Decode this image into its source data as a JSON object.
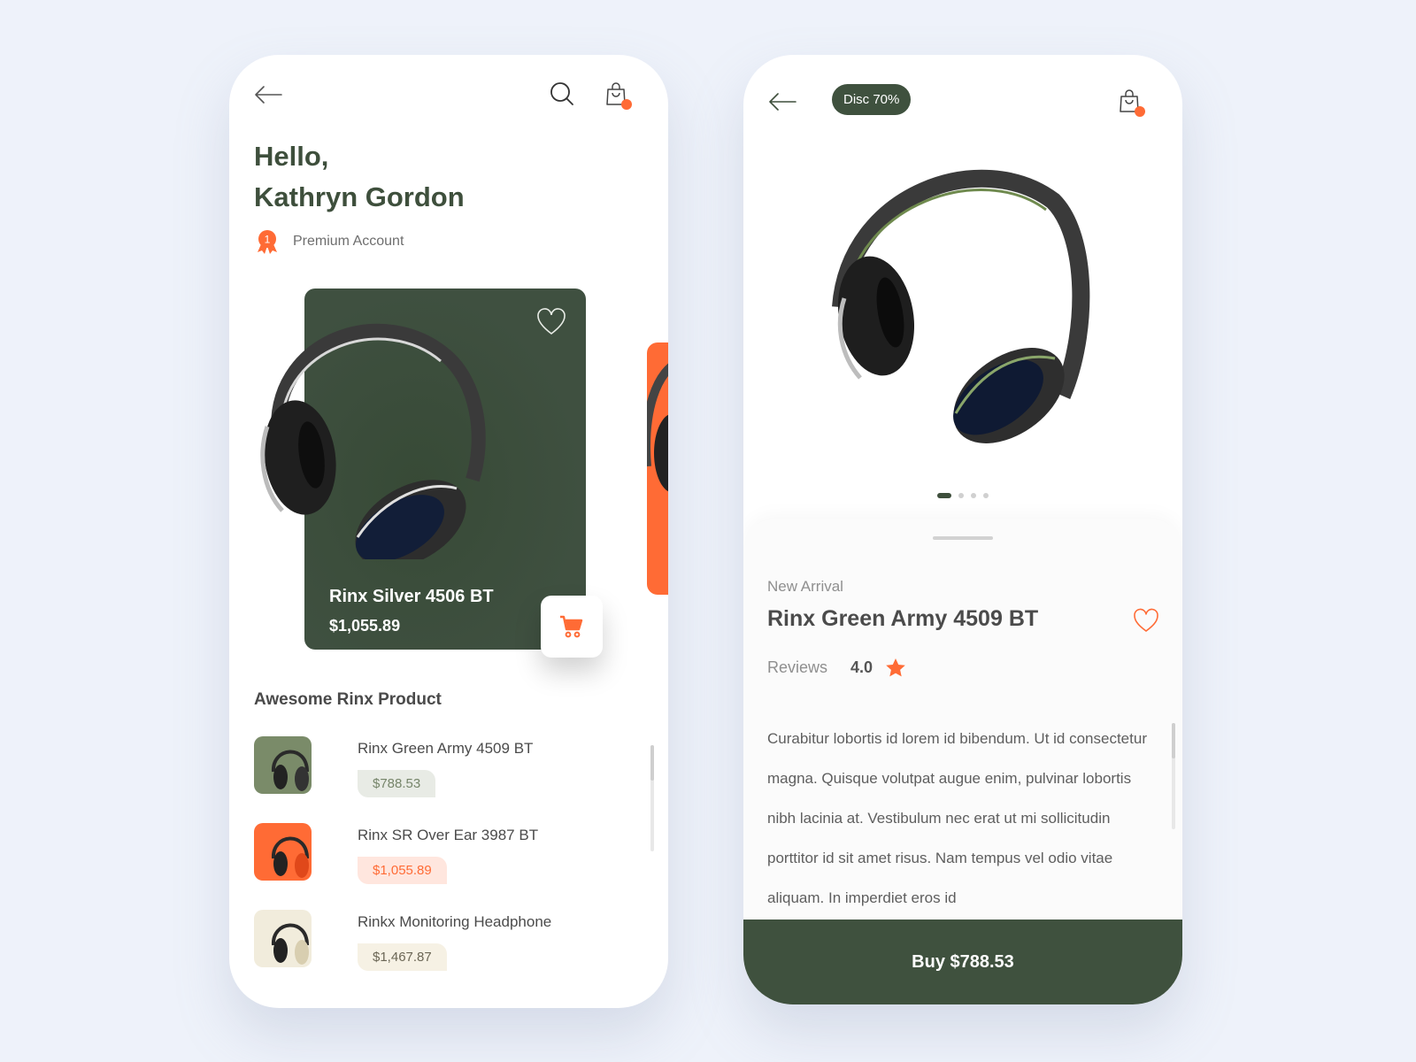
{
  "colors": {
    "background": "#eef2fa",
    "brand_green": "#3f513e",
    "accent_orange": "#ff6b35"
  },
  "home": {
    "header": {
      "back_icon": "arrow-left-icon",
      "search_icon": "search-icon",
      "bag_icon": "shopping-bag-icon"
    },
    "greeting": {
      "line1": "Hello,",
      "line2": "Kathryn Gordon"
    },
    "account": {
      "badge_number": "1",
      "label": "Premium Account"
    },
    "featured": {
      "name": "Rinx Silver 4506 BT",
      "price": "$1,055.89",
      "favorite_icon": "heart-icon",
      "cart_icon": "cart-icon"
    },
    "section_title": "Awesome Rinx Product",
    "products": [
      {
        "name": "Rinx Green Army 4509 BT",
        "price": "$788.53",
        "thumb_color": "#7a8b69",
        "price_bg": "#e8ebe5",
        "price_color": "#76856a"
      },
      {
        "name": "Rinx SR Over Ear 3987 BT",
        "price": "$1,055.89",
        "thumb_color": "#ff6b35",
        "price_bg": "#ffe6de",
        "price_color": "#ff6b35"
      },
      {
        "name": "Rinkx Monitoring Headphone",
        "price": "$1,467.87",
        "thumb_color": "#f1ecdc",
        "price_bg": "#f6f1e4",
        "price_color": "#6b6655"
      }
    ]
  },
  "detail": {
    "header": {
      "back_icon": "arrow-left-icon",
      "discount_badge": "Disc 70%",
      "bag_icon": "shopping-bag-icon"
    },
    "carousel": {
      "total": 4,
      "active": 1
    },
    "tag": "New Arrival",
    "title": "Rinx Green Army 4509 BT",
    "reviews_label": "Reviews",
    "rating": "4.0",
    "description": "Curabitur lobortis id lorem id bibendum. Ut id consectetur magna. Quisque volutpat augue enim, pulvinar lobortis nibh lacinia at. Vestibulum nec erat ut mi sollicitudin porttitor id sit amet risus. Nam tempus vel odio vitae aliquam. In imperdiet eros id",
    "buy_label": "Buy $788.53"
  }
}
